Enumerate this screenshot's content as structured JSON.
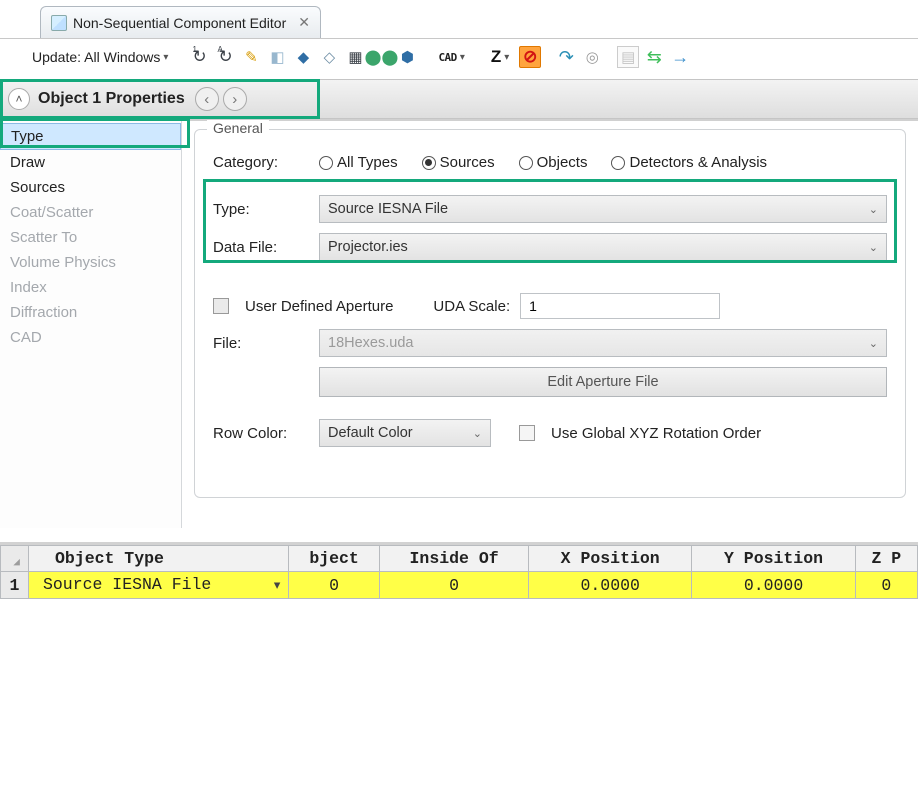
{
  "tab": {
    "title": "Non-Sequential Component Editor"
  },
  "toolbar": {
    "update_label": "Update: All Windows",
    "cad_label": "CAD",
    "z_label": "Z"
  },
  "header": {
    "title": "Object  1 Properties"
  },
  "sidebar": {
    "items": [
      {
        "label": "Type",
        "selected": true,
        "dim": false
      },
      {
        "label": "Draw",
        "selected": false,
        "dim": false
      },
      {
        "label": "Sources",
        "selected": false,
        "dim": false
      },
      {
        "label": "Coat/Scatter",
        "selected": false,
        "dim": true
      },
      {
        "label": "Scatter To",
        "selected": false,
        "dim": true
      },
      {
        "label": "Volume Physics",
        "selected": false,
        "dim": true
      },
      {
        "label": "Index",
        "selected": false,
        "dim": true
      },
      {
        "label": "Diffraction",
        "selected": false,
        "dim": true
      },
      {
        "label": "CAD",
        "selected": false,
        "dim": true
      }
    ]
  },
  "general": {
    "group_label": "General",
    "category_label": "Category:",
    "categories": {
      "all": "All Types",
      "sources": "Sources",
      "objects": "Objects",
      "detectors": "Detectors & Analysis"
    },
    "selected_category": "sources",
    "type_label": "Type:",
    "type_value": "Source IESNA File",
    "datafile_label": "Data File:",
    "datafile_value": "Projector.ies",
    "uda_label": "User Defined Aperture",
    "uda_scale_label": "UDA Scale:",
    "uda_scale_value": "1",
    "file_label": "File:",
    "file_value": "18Hexes.uda",
    "edit_aperture_label": "Edit Aperture File",
    "rowcolor_label": "Row Color:",
    "rowcolor_value": "Default Color",
    "global_rot_label": "Use Global XYZ Rotation Order"
  },
  "grid": {
    "headers": {
      "objtype": "Object Type",
      "bject": "bject",
      "inside": "Inside Of",
      "xpos": "X Position",
      "ypos": "Y Position",
      "zp": "Z P"
    },
    "row1": {
      "objtype": "Source IESNA File",
      "bject": "0",
      "inside": "0",
      "xpos": "0.0000",
      "ypos": "0.0000",
      "zp": "0"
    }
  }
}
